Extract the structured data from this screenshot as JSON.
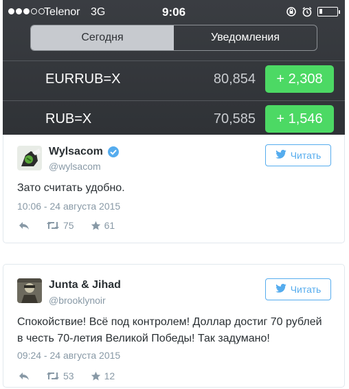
{
  "status_bar": {
    "signal_dots_filled": 3,
    "signal_dots_total": 5,
    "carrier": "Telenor",
    "network": "3G",
    "time": "9:06"
  },
  "notification_center": {
    "tabs": [
      {
        "label": "Сегодня",
        "active": true
      },
      {
        "label": "Уведомления",
        "active": false
      }
    ],
    "stocks": [
      {
        "symbol": "EURRUB=X",
        "price": "80,854",
        "change": "+ 2,308"
      },
      {
        "symbol": "RUB=X",
        "price": "70,585",
        "change": "+ 1,546"
      }
    ],
    "colors": {
      "change_positive": "#4cd964",
      "background": "#33363b"
    }
  },
  "tweets": [
    {
      "author": "Wylsacom",
      "handle": "@wylsacom",
      "verified": true,
      "follow_label": "Читать",
      "text": "Зато считать удобно.",
      "date": "10:06 - 24 августа 2015",
      "retweets": "75",
      "likes": "61"
    },
    {
      "author": "Junta & Jihad",
      "handle": "@brooklynoir",
      "verified": false,
      "follow_label": "Читать",
      "text": "Спокойствие! Всё под контролем! Доллар достиг 70 рублей в честь 70-летия Великой Победы! Так задумано!",
      "date": "09:24 - 24 августа 2015",
      "retweets": "53",
      "likes": "12"
    }
  ],
  "colors": {
    "twitter_blue": "#55acee",
    "muted": "#8899a6",
    "text": "#292f33"
  },
  "icons": [
    "lock-rotation-icon",
    "alarm-icon",
    "battery-icon",
    "verified-badge-icon",
    "twitter-bird-icon",
    "reply-icon",
    "retweet-icon",
    "like-star-icon"
  ]
}
